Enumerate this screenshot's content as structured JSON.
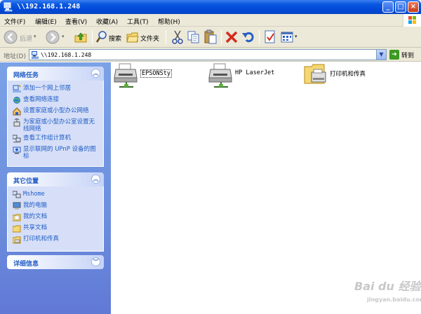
{
  "window": {
    "title": "\\\\192.168.1.248"
  },
  "menubar": {
    "items": [
      "文件(F)",
      "编辑(E)",
      "查看(V)",
      "收藏(A)",
      "工具(T)",
      "帮助(H)"
    ]
  },
  "toolbar": {
    "back_label": "后退",
    "search_label": "搜索",
    "folders_label": "文件夹",
    "icons": [
      "back-icon",
      "forward-icon",
      "up-icon",
      "search-icon",
      "folders-icon",
      "cut-icon",
      "copy-icon",
      "paste-icon",
      "delete-icon",
      "undo-icon",
      "properties-icon",
      "views-icon"
    ]
  },
  "address": {
    "label": "地址(D)",
    "value": "\\\\192.168.1.248",
    "go_label": "转到"
  },
  "sidebar": {
    "tasks": {
      "title": "网络任务",
      "items": [
        {
          "label": "添加一个网上邻居"
        },
        {
          "label": "查看网络连接"
        },
        {
          "label": "设置家庭或小型办公网络"
        },
        {
          "label": "为家庭或小型办公室设置无线网络"
        },
        {
          "label": "查看工作组计算机"
        },
        {
          "label": "显示联网的 UPnP 设备的图标"
        }
      ]
    },
    "places": {
      "title": "其它位置",
      "items": [
        {
          "label": "Mshome"
        },
        {
          "label": "我的电脑"
        },
        {
          "label": "我的文档"
        },
        {
          "label": "共享文档"
        },
        {
          "label": "打印机和传真"
        }
      ]
    },
    "details": {
      "title": "详细信息"
    }
  },
  "files": [
    {
      "name": "EPSONSty",
      "type": "printer",
      "selected": true
    },
    {
      "name": "HP LaserJet",
      "type": "printer",
      "selected": false
    },
    {
      "name": "打印机和传真",
      "type": "printers-folder",
      "selected": false
    }
  ],
  "watermark": {
    "brand": "Bai du 经验",
    "url": "jingyan.baidu.com"
  },
  "colors": {
    "title_blue": "#0a58e0",
    "link_blue": "#215dc6",
    "sidebar_bg": "#6c8fdd",
    "chrome": "#ece9d8"
  }
}
